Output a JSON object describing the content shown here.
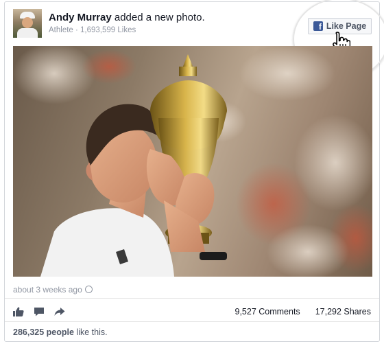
{
  "post": {
    "author": "Andy Murray",
    "action": "added a new photo.",
    "subtitle": "Athlete · 1,693,599 Likes",
    "like_page_label": "Like Page",
    "timestamp": "about 3 weeks ago",
    "comments": "9,527 Comments",
    "shares": "17,292 Shares",
    "likes_count": "286,325 people",
    "likes_suffix": "like this."
  },
  "icons": [
    "facebook-logo-icon",
    "hand-pointer-cursor-icon",
    "globe-icon",
    "thumbs-up-icon",
    "comment-icon",
    "share-icon"
  ],
  "colors": {
    "brand": "#3b5998",
    "muted": "#9197a3",
    "text": "#141823"
  }
}
